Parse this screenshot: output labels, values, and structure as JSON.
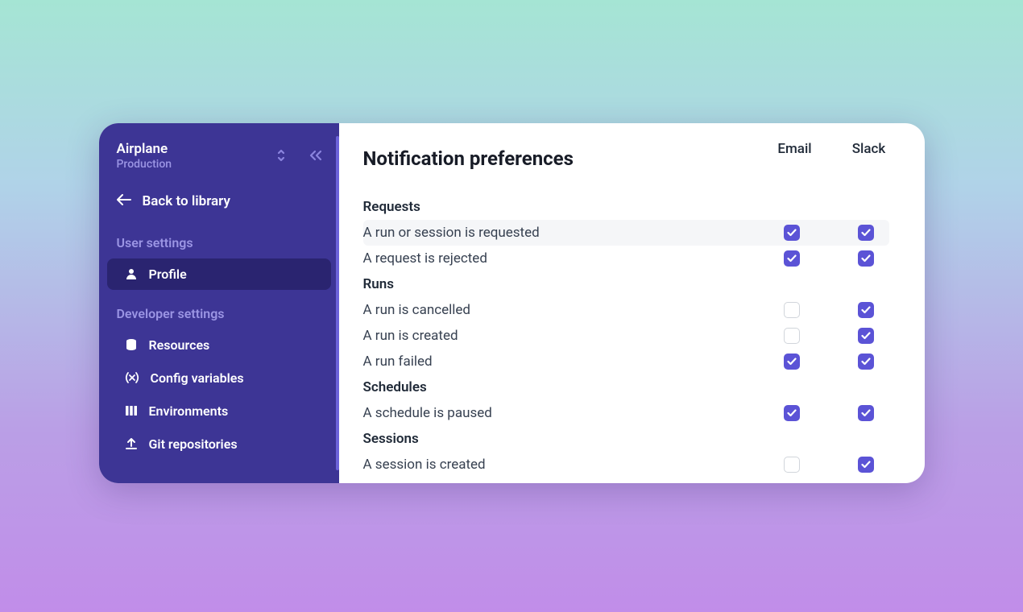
{
  "sidebar": {
    "workspace_name": "Airplane",
    "workspace_env": "Production",
    "back_label": "Back to library",
    "sections": [
      {
        "title": "User settings",
        "items": [
          {
            "icon": "user",
            "label": "Profile",
            "active": true
          }
        ]
      },
      {
        "title": "Developer settings",
        "items": [
          {
            "icon": "database",
            "label": "Resources"
          },
          {
            "icon": "variable",
            "label": "Config variables"
          },
          {
            "icon": "columns",
            "label": "Environments"
          },
          {
            "icon": "upload",
            "label": "Git repositories"
          }
        ]
      }
    ]
  },
  "main": {
    "title": "Notification preferences",
    "columns": [
      "Email",
      "Slack"
    ],
    "groups": [
      {
        "title": "Requests",
        "rows": [
          {
            "label": "A run or session is requested",
            "email": true,
            "slack": true,
            "highlight": true
          },
          {
            "label": "A request is rejected",
            "email": true,
            "slack": true
          }
        ]
      },
      {
        "title": "Runs",
        "rows": [
          {
            "label": "A run is cancelled",
            "email": false,
            "slack": true
          },
          {
            "label": "A run is created",
            "email": false,
            "slack": true
          },
          {
            "label": "A run failed",
            "email": true,
            "slack": true
          }
        ]
      },
      {
        "title": "Schedules",
        "rows": [
          {
            "label": "A schedule is paused",
            "email": true,
            "slack": true
          }
        ]
      },
      {
        "title": "Sessions",
        "rows": [
          {
            "label": "A session is created",
            "email": false,
            "slack": true
          }
        ]
      }
    ]
  }
}
